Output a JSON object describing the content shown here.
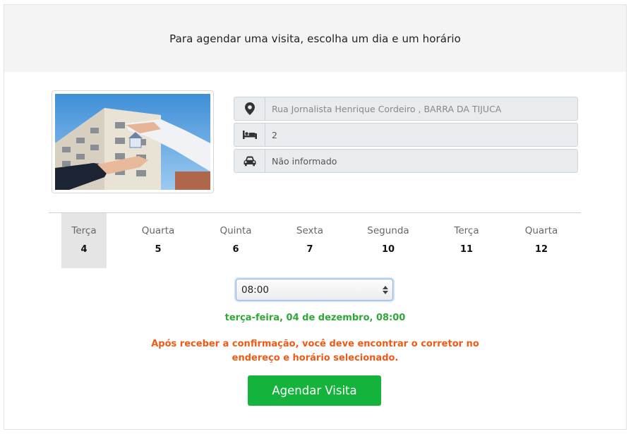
{
  "header": {
    "title": "Para agendar uma visita, escolha um dia e um horário"
  },
  "property": {
    "address": "Rua Jornalista Henrique Cordeiro , BARRA DA TIJUCA",
    "bedrooms": "2",
    "parking": "Não informado",
    "icons": {
      "address": "map-marker-icon",
      "bedrooms": "bed-icon",
      "parking": "car-icon"
    }
  },
  "days": [
    {
      "name": "Terça",
      "date": "4",
      "selected": true
    },
    {
      "name": "Quarta",
      "date": "5"
    },
    {
      "name": "Quinta",
      "date": "6"
    },
    {
      "name": "Sexta",
      "date": "7"
    },
    {
      "name": "Segunda",
      "date": "10"
    },
    {
      "name": "Terça",
      "date": "11"
    },
    {
      "name": "Quarta",
      "date": "12"
    }
  ],
  "time_select": {
    "value": "08:00"
  },
  "selection_summary": "terça-feira, 04 de dezembro, 08:00",
  "warning": {
    "line1": "Após receber a confirmação, você deve encontrar o corretor no",
    "line2": "endereço e horário selecionado."
  },
  "submit": {
    "label": "Agendar Visita"
  },
  "colors": {
    "header_bg": "#f4f4f4",
    "confirm_text": "#2ea836",
    "warning_text": "#f05a14",
    "button_bg": "#14b43c",
    "selected_day_bg": "#e5e5e5"
  }
}
